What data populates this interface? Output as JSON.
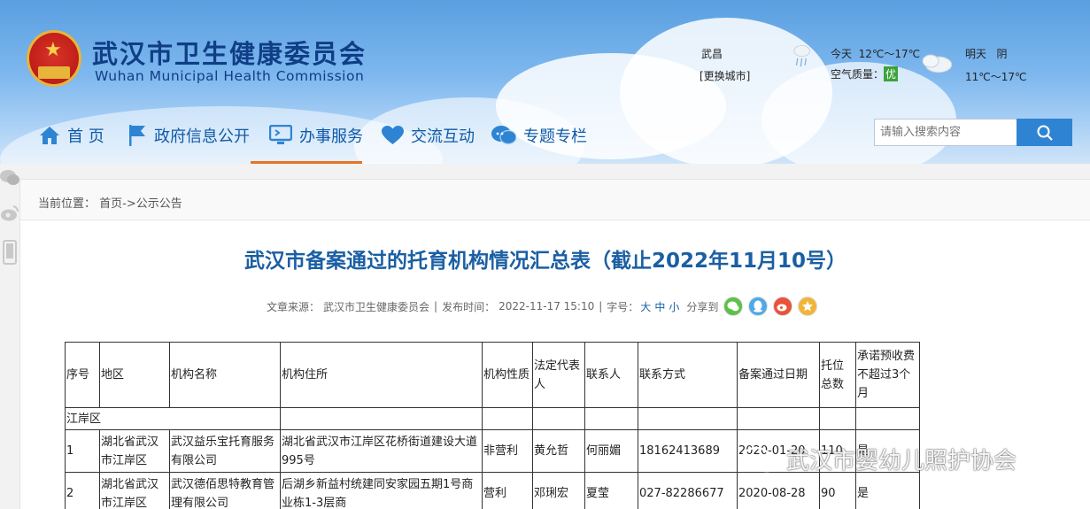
{
  "header": {
    "title_cn": "武汉市卫生健康委员会",
    "title_en": "Wuhan Municipal Health Commission",
    "weather": {
      "city": "武昌",
      "change_city": "[更换城市]",
      "today_label": "今天",
      "today_temp": "12℃～17℃",
      "aqi_label": "空气质量：",
      "aqi_value": "优",
      "tomorrow_label": "明天",
      "tomorrow_condition": "阴",
      "tomorrow_temp": "11℃～17℃"
    }
  },
  "nav": {
    "items": [
      {
        "label": "首 页",
        "icon": "home-icon"
      },
      {
        "label": "政府信息公开",
        "icon": "flag-icon"
      },
      {
        "label": "办事服务",
        "icon": "monitor-icon",
        "active": true
      },
      {
        "label": "交流互动",
        "icon": "heart-icon"
      },
      {
        "label": "专题专栏",
        "icon": "chat-icon"
      }
    ],
    "active_color": "#e4742a"
  },
  "search": {
    "placeholder": "请输入搜索内容"
  },
  "breadcrumb": {
    "label": "当前位置：",
    "path": "首页->公示公告"
  },
  "article": {
    "title": "武汉市备案通过的托育机构情况汇总表（截止2022年11月10号）",
    "meta": {
      "source_label": "文章来源：",
      "source": "武汉市卫生健康委员会",
      "date_label": "发布时间：",
      "date": "2022-11-17 15:10",
      "font_label": "字号：",
      "font_large": "大",
      "font_medium": "中",
      "font_small": "小",
      "share_label": "分享到"
    }
  },
  "table": {
    "headers": [
      "序号",
      "地区",
      "机构名称",
      "机构住所",
      "机构性质",
      "法定代表人",
      "联系人",
      "联系方式",
      "备案通过日期",
      "托位总数",
      "承诺预收费不超过3个月"
    ],
    "section": "江岸区",
    "rows": [
      [
        "1",
        "湖北省武汉市江岸区",
        "武汉益乐宝托育服务有限公司",
        "湖北省武汉市江岸区花桥街道建设大道995号",
        "非营利",
        "黄允哲",
        "何丽媚",
        "18162413689",
        "2020-01-20",
        "110",
        "是"
      ],
      [
        "2",
        "湖北省武汉市江岸区",
        "武汉德佰思特教育管理有限公司",
        "后湖乡新益村统建同安家园五期1号商业栋1-3层商",
        "营利",
        "邓琍宏",
        "夏莹",
        "027-82286677",
        "2020-08-28",
        "90",
        "是"
      ]
    ]
  },
  "watermark": "武汉市婴幼儿照护协会"
}
